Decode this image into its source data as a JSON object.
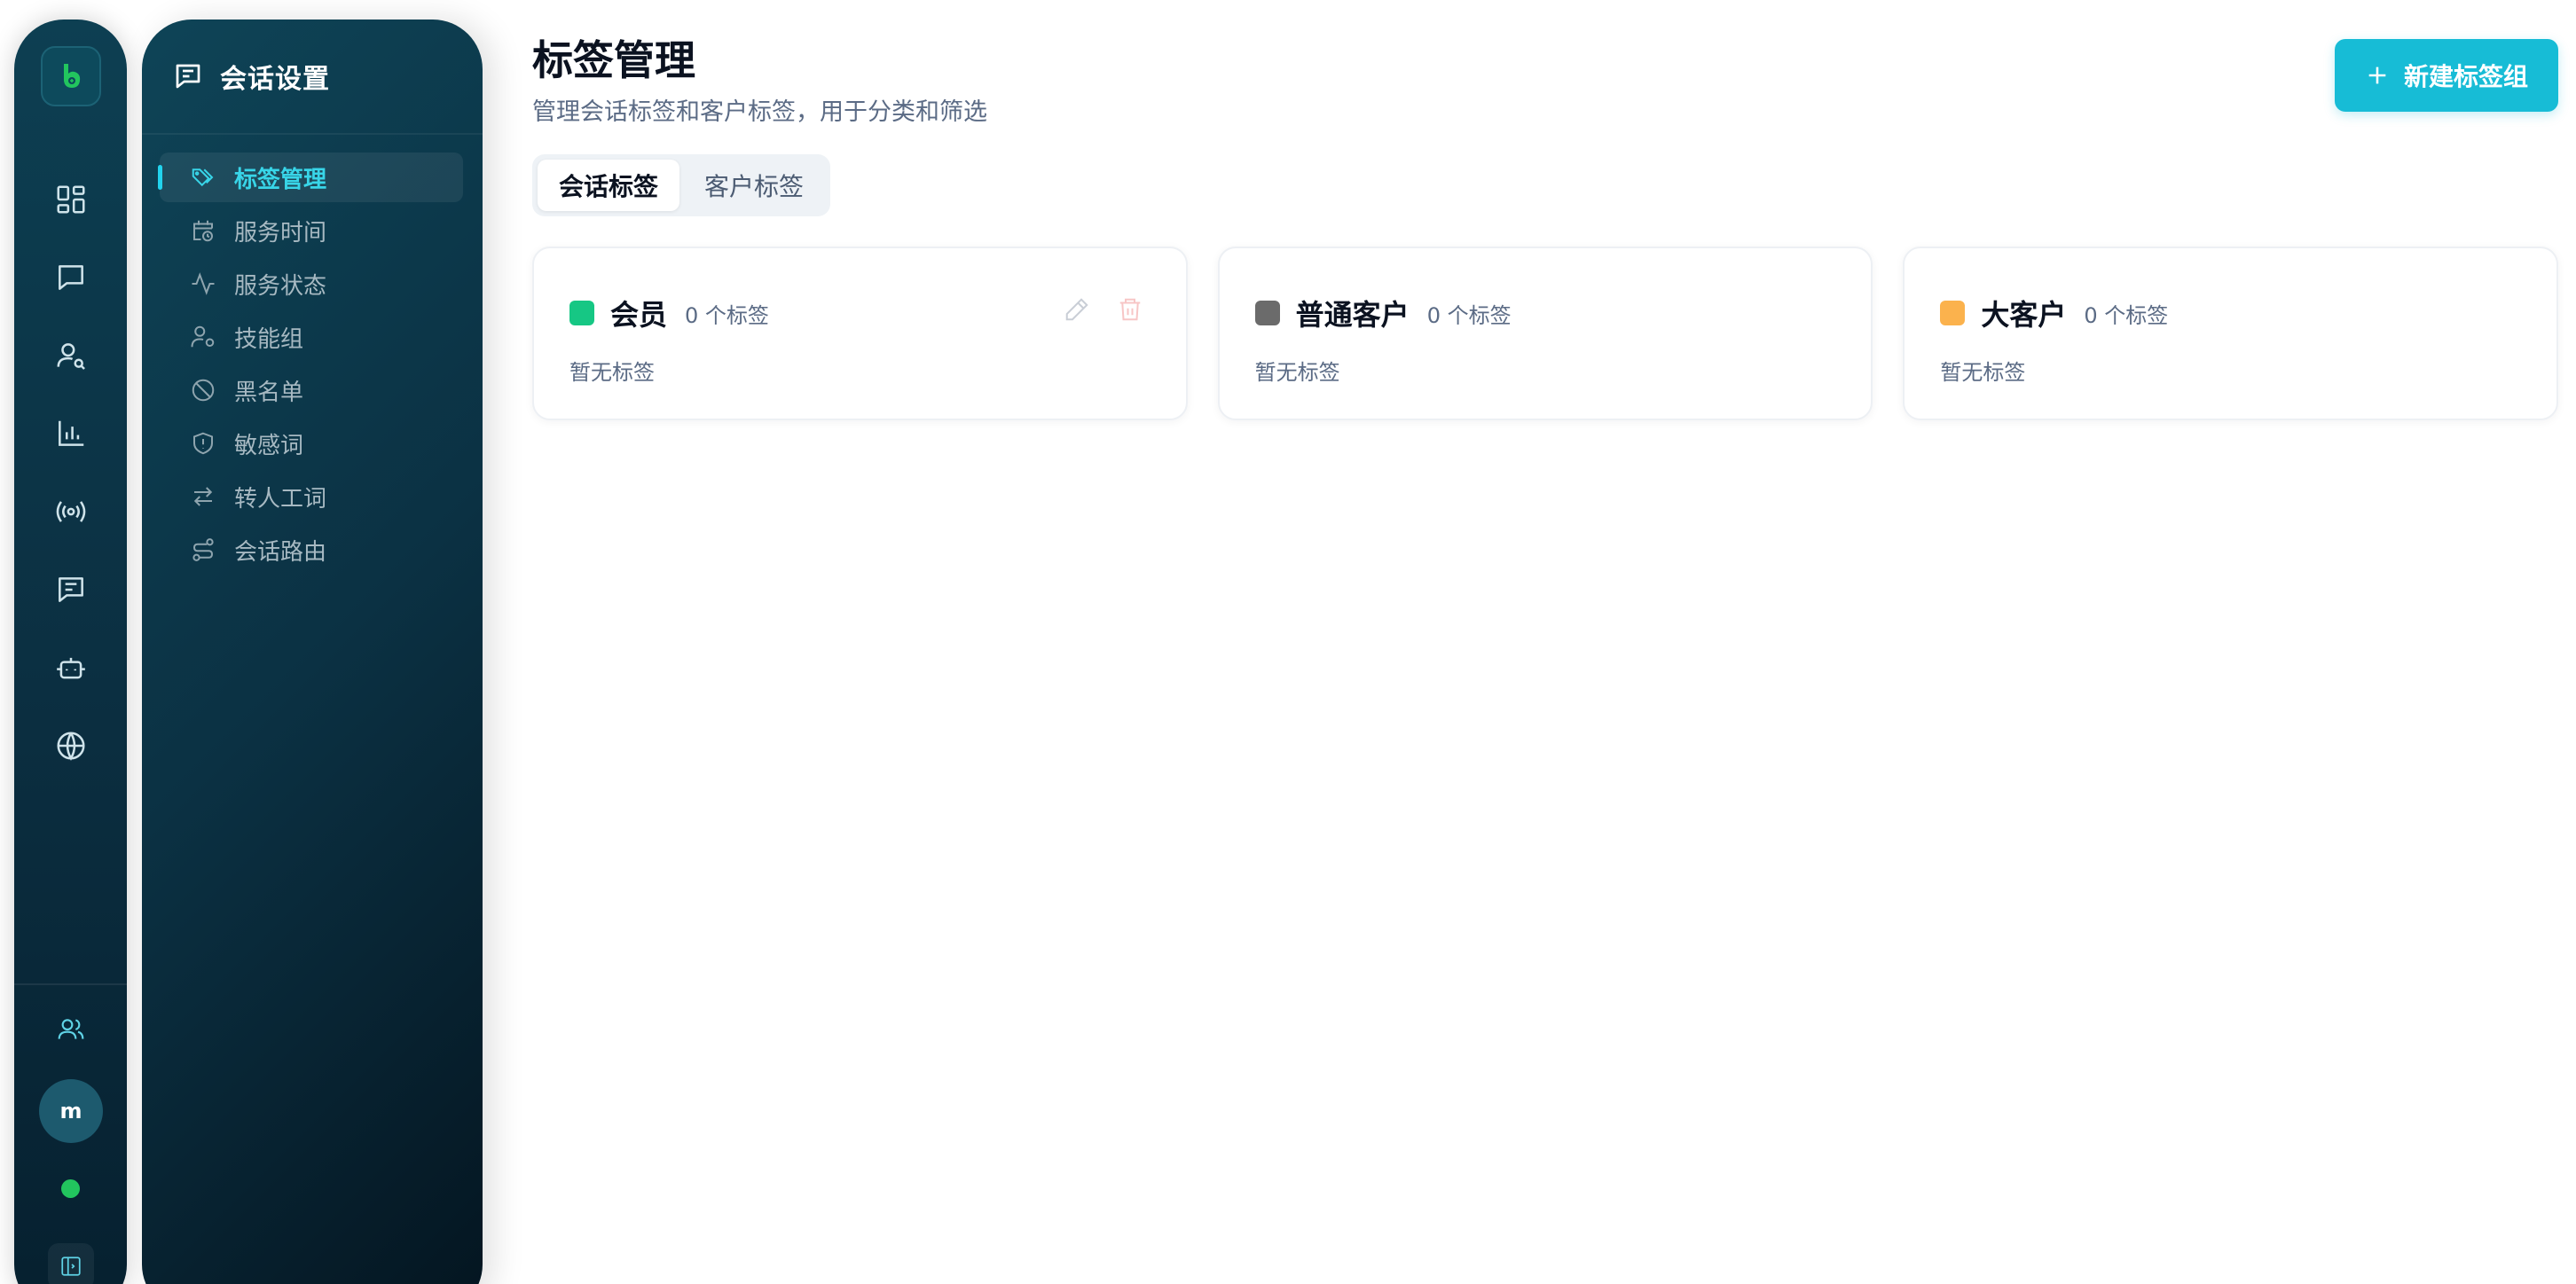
{
  "rail": {
    "logo_icon": "app-logo-icon",
    "items": [
      {
        "icon": "dashboard-grid-icon"
      },
      {
        "icon": "chat-bubble-icon"
      },
      {
        "icon": "user-search-icon"
      },
      {
        "icon": "bar-chart-icon"
      },
      {
        "icon": "broadcast-icon"
      },
      {
        "icon": "message-square-icon"
      },
      {
        "icon": "robot-icon"
      },
      {
        "icon": "globe-icon"
      }
    ],
    "team_icon": "users-icon",
    "avatar_initial": "m",
    "status_color": "#22c55e",
    "collapse_icon": "sidebar-toggle-icon"
  },
  "sidebar": {
    "title": "会话设置",
    "title_icon": "message-settings-icon",
    "items": [
      {
        "label": "标签管理",
        "icon": "tags-icon",
        "active": true
      },
      {
        "label": "服务时间",
        "icon": "calendar-clock-icon",
        "active": false
      },
      {
        "label": "服务状态",
        "icon": "activity-icon",
        "active": false
      },
      {
        "label": "技能组",
        "icon": "user-cog-icon",
        "active": false
      },
      {
        "label": "黑名单",
        "icon": "ban-icon",
        "active": false
      },
      {
        "label": "敏感词",
        "icon": "shield-icon",
        "active": false
      },
      {
        "label": "转人工词",
        "icon": "arrows-swap-icon",
        "active": false
      },
      {
        "label": "会话路由",
        "icon": "route-icon",
        "active": false
      }
    ]
  },
  "header": {
    "title": "标签管理",
    "subtitle": "管理会话标签和客户标签，用于分类和筛选",
    "new_button_label": "新建标签组"
  },
  "tabs": [
    {
      "label": "会话标签",
      "active": true
    },
    {
      "label": "客户标签",
      "active": false
    }
  ],
  "tag_groups": [
    {
      "name": "会员",
      "count": "0 个标签",
      "empty": "暂无标签",
      "color": "#16c784",
      "show_actions": true
    },
    {
      "name": "普通客户",
      "count": "0 个标签",
      "empty": "暂无标签",
      "color": "#6b6b6b",
      "show_actions": false
    },
    {
      "name": "大客户",
      "count": "0 个标签",
      "empty": "暂无标签",
      "color": "#fbb24d",
      "show_actions": false
    }
  ],
  "colors": {
    "accent": "#17bcd6",
    "active_menu": "#38d5e8"
  }
}
